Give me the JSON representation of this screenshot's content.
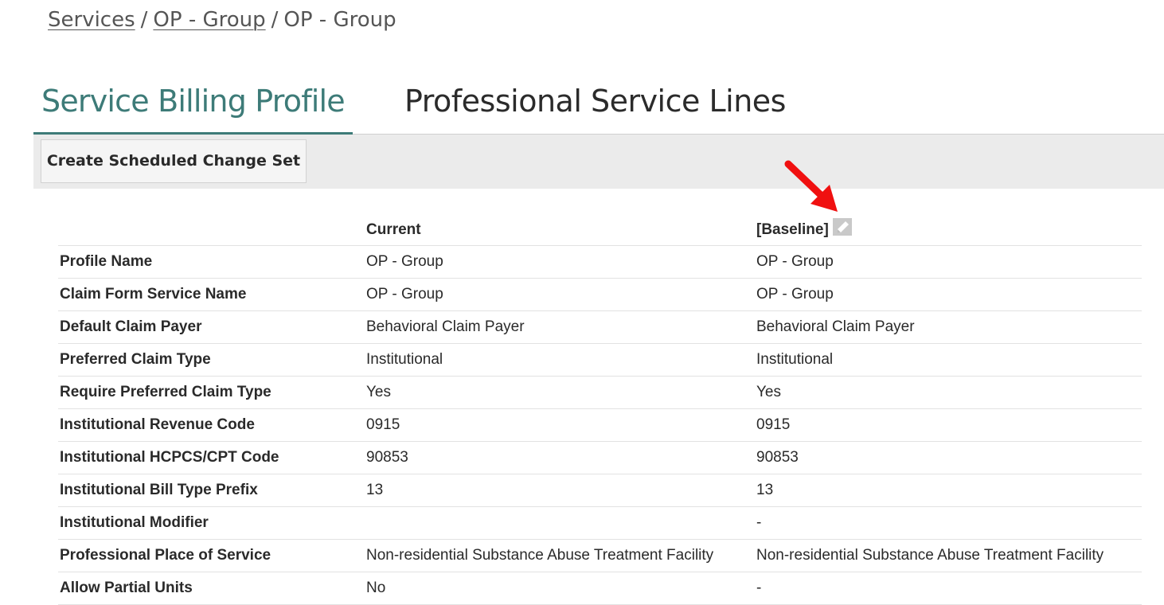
{
  "breadcrumb": {
    "items": [
      "Services",
      "OP - Group",
      "OP - Group"
    ],
    "separator": "/"
  },
  "tabs": [
    {
      "label": "Service Billing Profile",
      "active": true
    },
    {
      "label": "Professional Service Lines",
      "active": false
    }
  ],
  "toolbar": {
    "create_button_label": "Create Scheduled Change Set"
  },
  "table": {
    "headers": {
      "current": "Current",
      "baseline": "[Baseline]"
    },
    "rows": [
      {
        "label": "Profile Name",
        "current": "OP - Group",
        "baseline": "OP - Group"
      },
      {
        "label": "Claim Form Service Name",
        "current": "OP - Group",
        "baseline": "OP - Group"
      },
      {
        "label": "Default Claim Payer",
        "current": "Behavioral Claim Payer",
        "baseline": "Behavioral Claim Payer"
      },
      {
        "label": "Preferred Claim Type",
        "current": "Institutional",
        "baseline": "Institutional"
      },
      {
        "label": "Require Preferred Claim Type",
        "current": "Yes",
        "baseline": "Yes"
      },
      {
        "label": "Institutional Revenue Code",
        "current": "0915",
        "baseline": "0915"
      },
      {
        "label": "Institutional HCPCS/CPT Code",
        "current": "90853",
        "baseline": "90853"
      },
      {
        "label": "Institutional Bill Type Prefix",
        "current": "13",
        "baseline": "13"
      },
      {
        "label": "Institutional Modifier",
        "current": "",
        "baseline": "-"
      },
      {
        "label": "Professional Place of Service",
        "current": "Non-residential Substance Abuse Treatment Facility",
        "baseline": "Non-residential Substance Abuse Treatment Facility"
      },
      {
        "label": "Allow Partial Units",
        "current": "No",
        "baseline": "-"
      }
    ]
  },
  "icons": {
    "edit_baseline": "pencil-edit-icon",
    "annotation": "red-arrow-icon"
  },
  "colors": {
    "accent": "#3d7b78",
    "annotation": "#f01010",
    "toolbar_bg": "#ebebeb"
  }
}
